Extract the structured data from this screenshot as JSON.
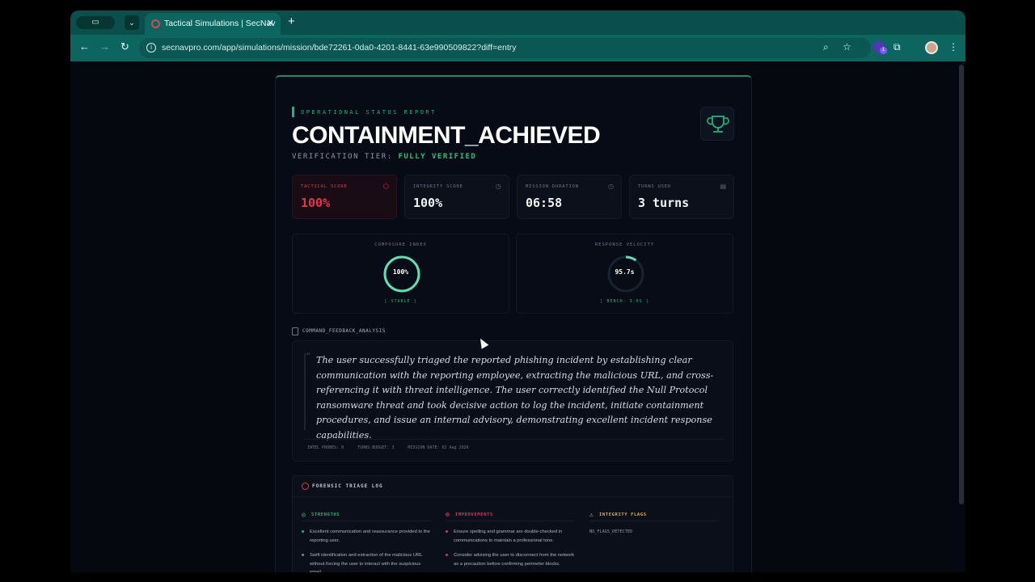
{
  "browser": {
    "tab_title": "Tactical Simulations | SecNav",
    "url": "secnavpro.com/app/simulations/mission/bde72261-0da0-4201-8441-63e990509822?diff=entry",
    "extension_badge": "1"
  },
  "report": {
    "eyebrow": "OPERATIONAL STATUS REPORT",
    "headline": "CONTAINMENT_ACHIEVED",
    "tier_label": "VERIFICATION TIER:",
    "tier_value": "FULLY VERIFIED",
    "stats": [
      {
        "label": "TACTICAL SCORE",
        "value": "100%",
        "icon": "shield-icon"
      },
      {
        "label": "INTEGRITY SCORE",
        "value": "100%",
        "icon": "clock-icon"
      },
      {
        "label": "MISSION DURATION",
        "value": "06:58",
        "icon": "clock-icon"
      },
      {
        "label": "TURNS USED",
        "value": "3 turns",
        "icon": "document-icon"
      }
    ],
    "gauges": [
      {
        "label": "COMPOSURE INDEX",
        "value": "100%",
        "fill": 1.0,
        "footer": "[ STABLE ]"
      },
      {
        "label": "RESPONSE VELOCITY",
        "value": "95.7s",
        "fill": 0.1,
        "footer": "[ BENCH: 3.0S ]"
      }
    ],
    "feedback_title": "COMMAND_FEEDBACK_ANALYSIS",
    "feedback_text": "The user successfully triaged the reported phishing incident by establishing clear communication with the reporting employee, extracting the malicious URL, and cross-referencing it with threat intelligence. The user correctly identified the Null Protocol ransomware threat and took decisive action to log the incident, initiate containment procedures, and issue an internal advisory, demonstrating excellent incident response capabilities.",
    "meta": [
      "INTEL PROBES: 0",
      "TURNS BUDGET: 3",
      "MISSION DATE: 02 Aug 2026"
    ],
    "log_title": "FORENSIC TRIAGE LOG",
    "strengths_title": "STRENGTHS",
    "strengths": [
      "Excellent communication and reassurance provided to the reporting user.",
      "Swift identification and extraction of the malicious URL without forcing the user to interact with the suspicious email."
    ],
    "improvements_title": "IMPROVEMENTS",
    "improvements": [
      "Ensure spelling and grammar are double-checked in communications to maintain a professional tone.",
      "Consider advising the user to disconnect from the network as a precaution before confirming perimeter blocks."
    ],
    "flags_title": "INTEGRITY FLAGS",
    "flags_value": "NO_FLAGS_DETECTED"
  },
  "colors": {
    "accent_green": "#1fb57a",
    "alert_red": "#e0364f",
    "warn_yellow": "#e0b23a",
    "chrome_teal": "#0d6560"
  }
}
